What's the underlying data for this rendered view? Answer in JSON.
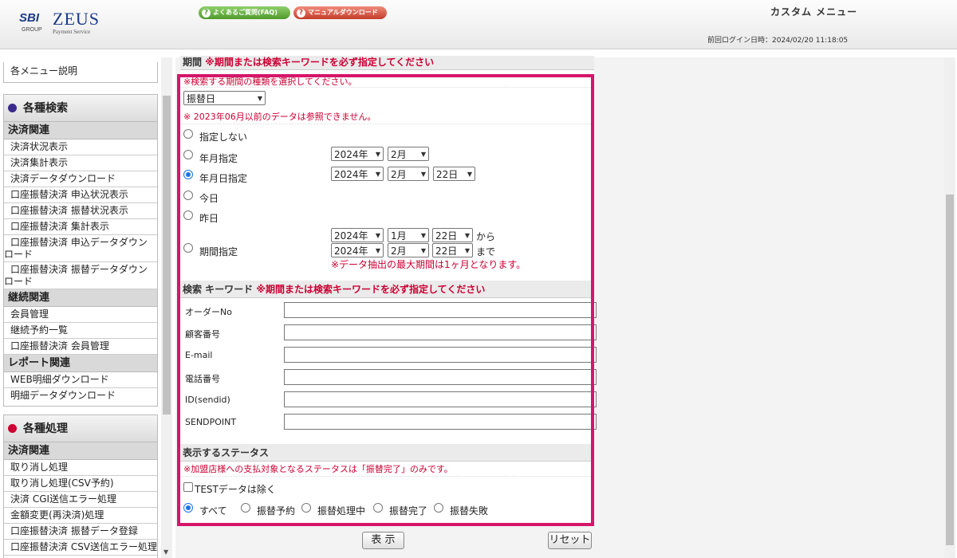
{
  "header": {
    "logo_sbi": "SBI",
    "logo_group": "GROUP",
    "logo_zeus": "ZEUS",
    "logo_sub": "Payment Service",
    "faq_label": "よくあるご質問(FAQ)",
    "manual_label": "マニュアルダウンロード",
    "custom_menu": "カスタム メニュー",
    "last_login": "前回ログイン日時：2024/02/20 11:18:05"
  },
  "sidebar": {
    "top_link": "各メニュー説明",
    "search": {
      "title": "各種検索",
      "cat_payment": "決済関連",
      "payment_items": [
        "決済状況表示",
        "決済集計表示",
        "決済データダウンロード",
        "口座振替決済 申込状況表示",
        "口座振替決済 振替状況表示",
        "口座振替決済 集計表示"
      ],
      "two_line_1": [
        "口座振替決済 申込データダウン",
        "ロード"
      ],
      "two_line_2": [
        "口座振替決済 振替データダウン",
        "ロード"
      ],
      "cat_continuous": "継続関連",
      "continuous_items": [
        "会員管理",
        "継続予約一覧",
        "口座振替決済 会員管理"
      ],
      "cat_report": "レポート関連",
      "report_items": [
        "WEB明細ダウンロード",
        "明細データダウンロード"
      ]
    },
    "process": {
      "title": "各種処理",
      "cat_payment": "決済関連",
      "items": [
        "取り消し処理",
        "取り消し処理(CSV予約)",
        "決済 CGI送信エラー処理",
        "金額変更(再決済)処理",
        "口座振替決済 振替データ登録",
        "口座振替決済 CSV送信エラー処理"
      ]
    }
  },
  "period": {
    "section_title": "期間",
    "section_warn": "※期間または検索キーワードを必ず指定してください",
    "select_hint": "※検索する期間の種類を選択してください。",
    "type_value": "振替日",
    "notice": "※ 2023年06月以前のデータは参照できません。",
    "opt_none": "指定しない",
    "opt_month": "年月指定",
    "opt_day": "年月日指定",
    "opt_today": "今日",
    "opt_yesterday": "昨日",
    "opt_range": "期間指定",
    "month_year": "2024年",
    "month_month": "2月",
    "day_year": "2024年",
    "day_month": "2月",
    "day_day": "22日",
    "range_from_year": "2024年",
    "range_from_month": "1月",
    "range_from_day": "22日",
    "from_word": "から",
    "range_to_year": "2024年",
    "range_to_month": "2月",
    "range_to_day": "22日",
    "to_word": "まで",
    "range_note": "※データ抽出の最大期間は1ヶ月となります。"
  },
  "keyword": {
    "section_title": "検索 キーワード",
    "section_warn": "※期間または検索キーワードを必ず指定してください",
    "fields": [
      "オーダーNo",
      "顧客番号",
      "E-mail",
      "電話番号",
      "ID(sendid)",
      "SENDPOINT"
    ]
  },
  "status": {
    "section_title": "表示するステータス",
    "notice": "※加盟店様への支払対象となるステータスは「振替完了」のみです。",
    "test_exclude": "TESTデータは除く",
    "options": [
      "すべて",
      "振替予約",
      "振替処理中",
      "振替完了",
      "振替失敗"
    ]
  },
  "buttons": {
    "show": "表 示",
    "reset": "リセット"
  }
}
